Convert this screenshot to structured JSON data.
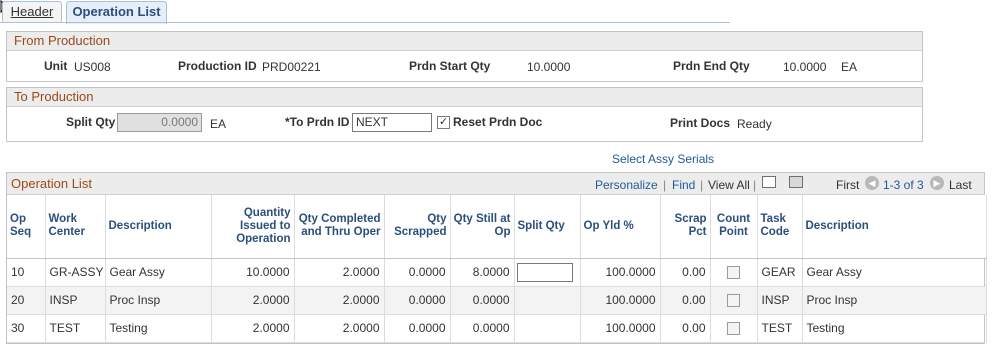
{
  "tabs": {
    "header": "Header",
    "operation_list": "Operation List"
  },
  "from_production": {
    "title": "From Production",
    "unit_label": "Unit",
    "unit_value": "US008",
    "production_id_label": "Production ID",
    "production_id_value": "PRD00221",
    "start_qty_label": "Prdn Start Qty",
    "start_qty_value": "10.0000",
    "end_qty_label": "Prdn End Qty",
    "end_qty_value": "10.0000",
    "end_qty_uom": "EA"
  },
  "to_production": {
    "title": "To Production",
    "split_qty_label": "Split Qty",
    "split_qty_value": "0.0000",
    "split_qty_uom": "EA",
    "to_prdn_id_label": "*To Prdn ID",
    "to_prdn_id_value": "NEXT",
    "reset_label": "Reset Prdn Doc",
    "reset_checked": true,
    "print_docs_label": "Print Docs",
    "print_docs_value": "Ready"
  },
  "select_assy_serials": "Select Assy Serials",
  "grid": {
    "title": "Operation List",
    "personalize": "Personalize",
    "find": "Find",
    "view_all": "View All",
    "first": "First",
    "range": "1-3 of 3",
    "last": "Last",
    "columns": [
      "Op Seq",
      "Work Center",
      "Description",
      "Quantity Issued to Operation",
      "Qty Completed and Thru Oper",
      "Qty Scrapped",
      "Qty Still at Op",
      "Split Qty",
      "Op Yld %",
      "Scrap Pct",
      "Count Point",
      "Task Code",
      "Description"
    ],
    "rows": [
      {
        "op_seq": "10",
        "work_center": "GR-ASSY",
        "description": "Gear Assy",
        "qty_issued": "10.0000",
        "qty_completed": "2.0000",
        "qty_scrapped": "0.0000",
        "qty_still": "8.0000",
        "split_editable": true,
        "op_yld": "100.0000",
        "scrap_pct": "0.00",
        "task_code": "GEAR",
        "task_desc": "Gear Assy"
      },
      {
        "op_seq": "20",
        "work_center": "INSP",
        "description": "Proc Insp",
        "qty_issued": "2.0000",
        "qty_completed": "2.0000",
        "qty_scrapped": "0.0000",
        "qty_still": "0.0000",
        "split_editable": false,
        "op_yld": "100.0000",
        "scrap_pct": "0.00",
        "task_code": "INSP",
        "task_desc": "Proc Insp"
      },
      {
        "op_seq": "30",
        "work_center": "TEST",
        "description": "Testing",
        "qty_issued": "2.0000",
        "qty_completed": "2.0000",
        "qty_scrapped": "0.0000",
        "qty_still": "0.0000",
        "split_editable": false,
        "op_yld": "100.0000",
        "scrap_pct": "0.00",
        "task_code": "TEST",
        "task_desc": "Testing"
      }
    ]
  },
  "colors": {
    "group_title": "#9a4a1a",
    "link": "#1f5a9c",
    "header_text": "#2b4f7d"
  },
  "icons": [
    "cursor-icon",
    "zoom-icon",
    "download-icon",
    "first-arrow-icon",
    "next-arrow-icon",
    "checkbox-check-icon"
  ]
}
